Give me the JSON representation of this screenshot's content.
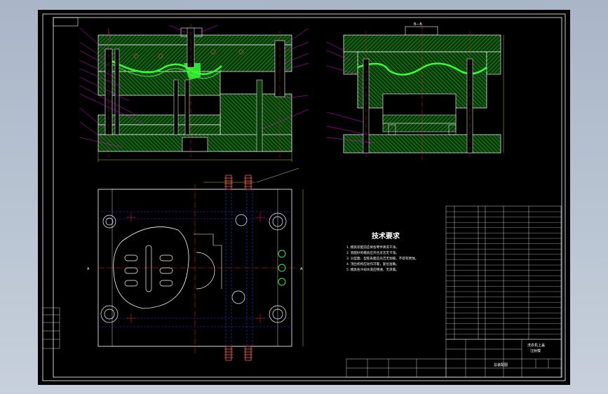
{
  "views": {
    "section_label": "B—B",
    "plan_label_left": "A",
    "plan_label_right": "A"
  },
  "tech_requirements": {
    "title": "技术要求",
    "lines": [
      "1. 模具装配前应将各零件清洗干净。",
      "2. 装配好的模具应开合灵活无卡滞。",
      "3. 分型面、型腔表面应光洁无划痕，不得有锈蚀。",
      "4. 顶出机构应动作可靠，复位准确。",
      "5. 模具各冷却水道应畅通，无渗漏。"
    ]
  },
  "title_block": {
    "title_line1": "洗衣机上盖",
    "title_line2": "注射模",
    "drawing_name": "总装配图"
  },
  "colors": {
    "background": "#000000",
    "hatch_green": "#1f8a1f",
    "plate_fill": "#0b3a0b",
    "outline_white": "#ffffff",
    "leader_magenta": "#ff00ff",
    "dim_yellow": "#ffff00",
    "center_red": "#ff2020",
    "hidden_blue": "#3030ff",
    "part_bright_green": "#33ff33"
  }
}
